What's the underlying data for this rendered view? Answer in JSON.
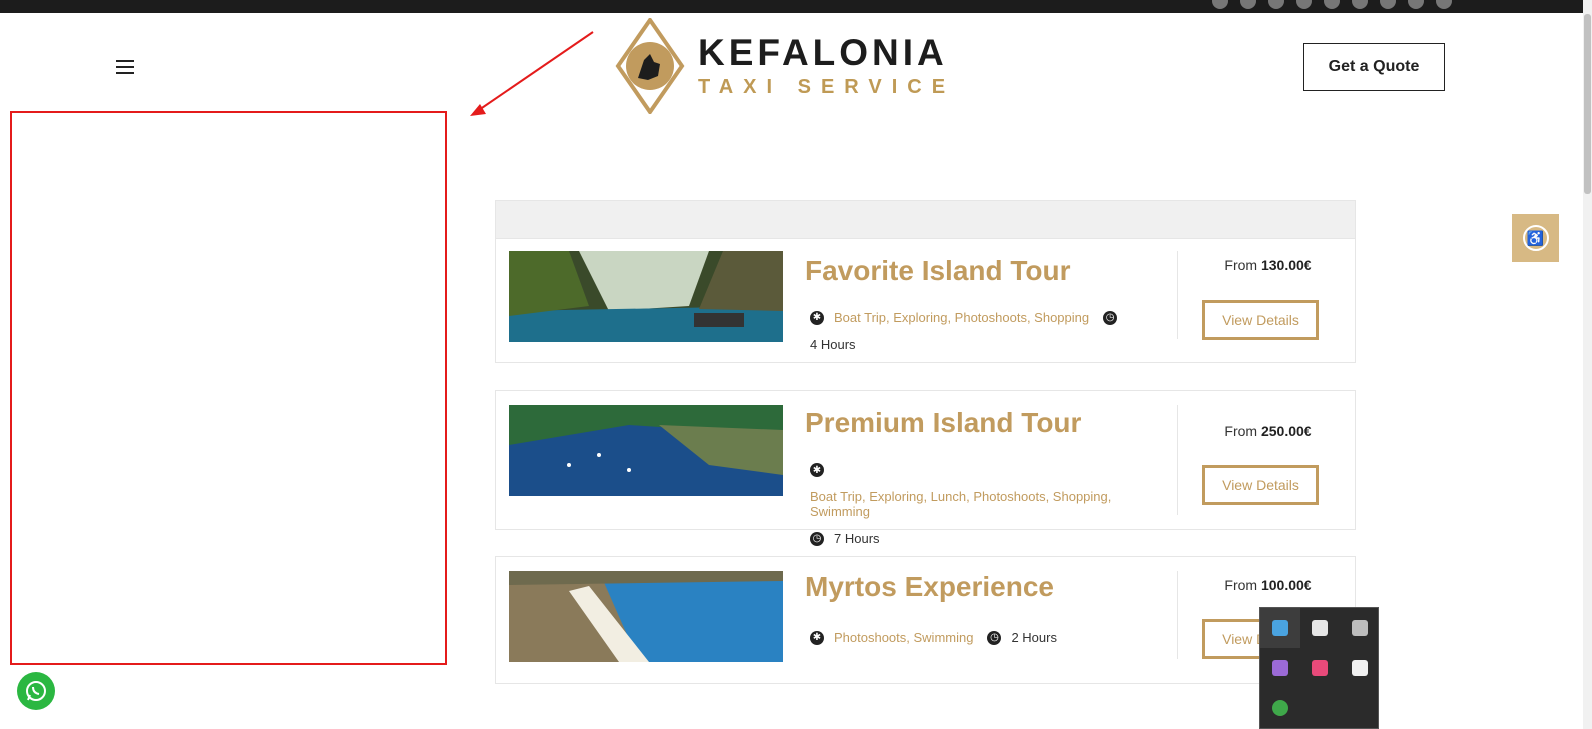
{
  "topbar": {
    "phone_text": "",
    "icons": [
      "skype-icon",
      "facebook-icon",
      "instagram-icon",
      "twitter-icon",
      "mail-icon",
      "linkedin-icon",
      "pinterest-icon",
      "tripadvisor-icon",
      "other-icon"
    ]
  },
  "header": {
    "logo_line1": "KEFALONIA",
    "logo_line2": "TAXI SERVICE",
    "quote_button": "Get a Quote"
  },
  "tours": [
    {
      "title": "Favorite Island Tour",
      "tags": "Boat Trip, Exploring, Photoshoots, Shopping",
      "duration": "4 Hours",
      "price_prefix": "From ",
      "price": "130.00€",
      "button": "View Details"
    },
    {
      "title": "Premium Island Tour",
      "tags": "Boat Trip, Exploring, Lunch, Photoshoots, Shopping, Swimming",
      "duration": "7 Hours",
      "price_prefix": "From ",
      "price": "250.00€",
      "button": "View Details"
    },
    {
      "title": "Myrtos Experience",
      "tags": "Photoshoots, Swimming",
      "duration": "2 Hours",
      "price_prefix": "From ",
      "price": "100.00€",
      "button": "View Details"
    }
  ],
  "colors": {
    "accent": "#c19b5e",
    "dark": "#1d1d1d",
    "annotation": "#e41b1b",
    "whatsapp": "#2bb741"
  },
  "tray_icons": [
    "network-tool-icon",
    "security-shield-icon",
    "cloud-offline-icon",
    "feather-app-icon",
    "bug-app-icon",
    "discord-icon",
    "utorrent-icon"
  ]
}
